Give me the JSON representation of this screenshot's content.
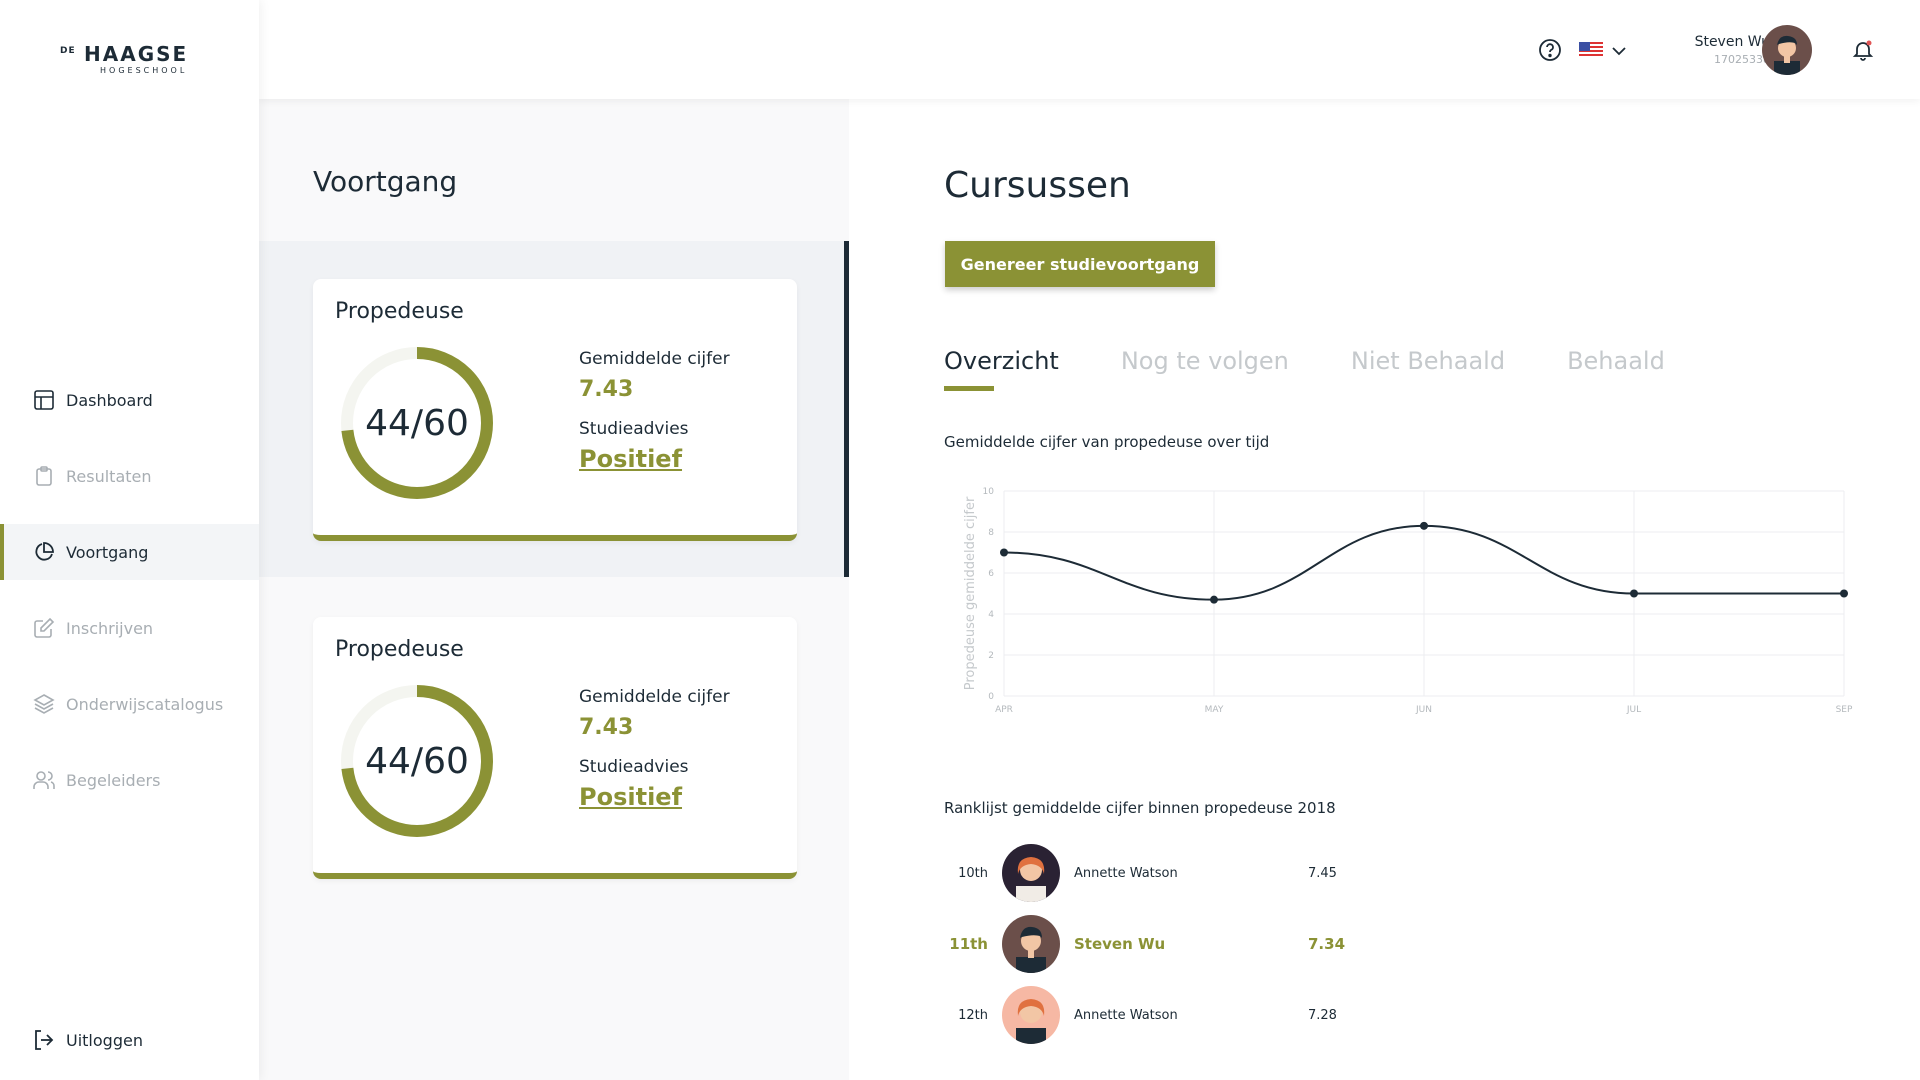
{
  "logo": {
    "de": "DE",
    "name": "HAAGSE",
    "sub": "HOGESCHOOL"
  },
  "sidebar": {
    "items": [
      {
        "label": "Dashboard",
        "icon": "layout-icon"
      },
      {
        "label": "Resultaten",
        "icon": "clipboard-icon"
      },
      {
        "label": "Voortgang",
        "icon": "pie-chart-icon"
      },
      {
        "label": "Inschrijven",
        "icon": "edit-icon"
      },
      {
        "label": "Onderwijscatalogus",
        "icon": "layers-icon"
      },
      {
        "label": "Begeleiders",
        "icon": "users-icon"
      }
    ],
    "active_index": 2,
    "logout_label": "Uitloggen"
  },
  "header": {
    "user_name": "Steven Wu",
    "user_id": "17025338",
    "language": "en-US"
  },
  "voortgang": {
    "title": "Voortgang",
    "cards": [
      {
        "title": "Propedeuse",
        "progress_text": "44/60",
        "progress": 0.733,
        "avg_label": "Gemiddelde cijfer",
        "avg_value": "7.43",
        "advice_label": "Studieadvies",
        "advice_value": "Positief"
      },
      {
        "title": "Propedeuse",
        "progress_text": "44/60",
        "progress": 0.733,
        "avg_label": "Gemiddelde cijfer",
        "avg_value": "7.43",
        "advice_label": "Studieadvies",
        "advice_value": "Positief"
      }
    ]
  },
  "cursussen": {
    "title": "Cursussen",
    "generate_button": "Genereer studievoortgang",
    "tabs": [
      "Overzicht",
      "Nog te volgen",
      "Niet Behaald",
      "Behaald"
    ],
    "active_tab": 0,
    "chart_title": "Gemiddelde cijfer van propedeuse over tijd",
    "ranking_title": "Ranklijst gemiddelde cijfer binnen propedeuse 2018",
    "ranking": [
      {
        "pos": "10th",
        "name": "Annette Watson",
        "score": "7.45",
        "me": false
      },
      {
        "pos": "11th",
        "name": "Steven Wu",
        "score": "7.34",
        "me": true
      },
      {
        "pos": "12th",
        "name": "Annette Watson",
        "score": "7.28",
        "me": false
      }
    ]
  },
  "chart_data": {
    "type": "line",
    "title": "Gemiddelde cijfer van propedeuse over tijd",
    "ylabel": "Propedeuse gemiddelde cijfer",
    "xlabel": "",
    "categories": [
      "APR",
      "MAY",
      "JUN",
      "JUL",
      "SEP"
    ],
    "values": [
      7.0,
      4.7,
      8.3,
      5.0,
      5.0
    ],
    "ylim": [
      0,
      10
    ],
    "yticks": [
      0,
      2,
      4,
      6,
      8,
      10
    ],
    "grid": true,
    "color": "#1d2b36"
  },
  "colors": {
    "accent": "#8b9235",
    "dark": "#1d2b36",
    "muted": "#a8aeb3"
  }
}
